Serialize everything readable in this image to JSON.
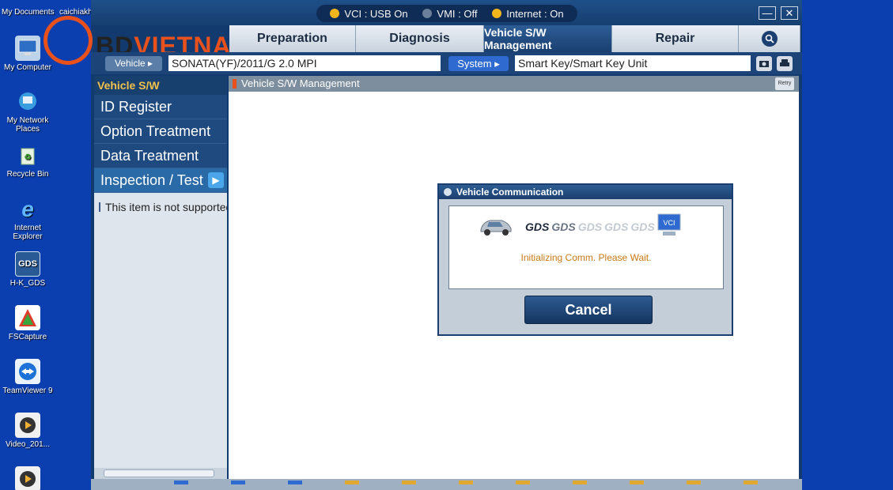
{
  "desktop": {
    "top_labels": [
      "My Documents",
      "caichiakh"
    ],
    "icons": [
      {
        "label": "My Computer",
        "icon": "computer-icon"
      },
      {
        "label": "My Network Places",
        "icon": "network-places-icon"
      },
      {
        "label": "Recycle Bin",
        "icon": "recycle-bin-icon"
      },
      {
        "label": "Internet Explorer",
        "icon": "internet-explorer-icon"
      },
      {
        "label": "H-K_GDS",
        "icon": "gds-icon",
        "glyph": "GDS"
      },
      {
        "label": "FSCapture",
        "icon": "fscapture-icon"
      },
      {
        "label": "TeamViewer 9",
        "icon": "teamviewer-icon"
      },
      {
        "label": "Video_201...",
        "icon": "video-file-icon"
      }
    ]
  },
  "logo": {
    "brand_a": "BD",
    "brand_b": "VIETNAM"
  },
  "status": {
    "vci": "VCI : USB On",
    "vmi": "VMI : Off",
    "internet": "Internet : On",
    "colors": {
      "on": "#f2b61d",
      "off": "#6a7f99"
    }
  },
  "window_controls": {
    "minimize": "—",
    "close": "✕"
  },
  "tabs": [
    {
      "label": "Preparation",
      "active": false
    },
    {
      "label": "Diagnosis",
      "active": false
    },
    {
      "label": "Vehicle S/W Management",
      "active": true
    },
    {
      "label": "Repair",
      "active": false
    }
  ],
  "vehicle_row": {
    "vehicle_button": "Vehicle",
    "vehicle_value": "SONATA(YF)/2011/G 2.0 MPI",
    "system_button": "System",
    "system_value": "Smart Key/Smart Key Unit"
  },
  "sidebar": {
    "header": "Vehicle S/W Management",
    "items": [
      {
        "label": "ID Register"
      },
      {
        "label": "Option Treatment"
      },
      {
        "label": "Data Treatment"
      },
      {
        "label": "Inspection / Test"
      }
    ],
    "notice": "This item is not supported"
  },
  "content": {
    "header": "Vehicle S/W Management",
    "retry_label": "Retry"
  },
  "dialog": {
    "title": "Vehicle Communication",
    "gds_logos": [
      "GDS",
      "GDS",
      "GDS",
      "GDS",
      "GDS"
    ],
    "vci_label": "VCI",
    "message": "Initializing Comm. Please Wait.",
    "cancel": "Cancel"
  },
  "colors": {
    "desktop_bg": "#0b3fb0",
    "accent_orange": "#e8511c",
    "sidebar_header_text": "#f2c14b",
    "message_text": "#c77a18"
  }
}
